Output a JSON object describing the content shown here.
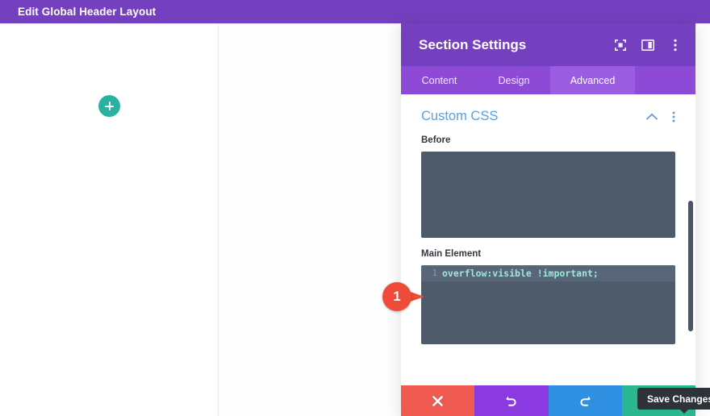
{
  "topbar": {
    "title": "Edit Global Header Layout",
    "bg_color": "#7540bf"
  },
  "canvas": {
    "add_section_icon": "plus-icon",
    "add_section_color": "#2ab2a0"
  },
  "modal": {
    "title": "Section Settings",
    "header_color": "#7540bf",
    "header_icons": [
      {
        "name": "focus-mode-icon"
      },
      {
        "name": "panel-layout-icon"
      },
      {
        "name": "more-options-icon"
      }
    ],
    "tabs": [
      {
        "label": "Content",
        "active": false
      },
      {
        "label": "Design",
        "active": false
      },
      {
        "label": "Advanced",
        "active": true
      }
    ],
    "section": {
      "title": "Custom CSS",
      "title_color": "#5a9fe0",
      "collapse_icon": "chevron-up-icon",
      "menu_icon": "more-options-icon"
    },
    "fields": [
      {
        "label": "Before",
        "name": "before-css",
        "value": "",
        "line_number": ""
      },
      {
        "label": "Main Element",
        "name": "main-element-css",
        "value": "overflow:visible !important;",
        "line_number": "1"
      }
    ],
    "footer_buttons": [
      {
        "name": "cancel-button",
        "icon": "close-icon",
        "color": "#ef5a50"
      },
      {
        "name": "undo-button",
        "icon": "undo-icon",
        "color": "#8b39e0"
      },
      {
        "name": "redo-button",
        "icon": "redo-icon",
        "color": "#2f8fe0"
      },
      {
        "name": "save-button",
        "icon": "check-icon",
        "color": "#2ab78f"
      }
    ],
    "save_tooltip": "Save Changes"
  },
  "annotation": {
    "number": "1",
    "color": "#ee4b38"
  }
}
